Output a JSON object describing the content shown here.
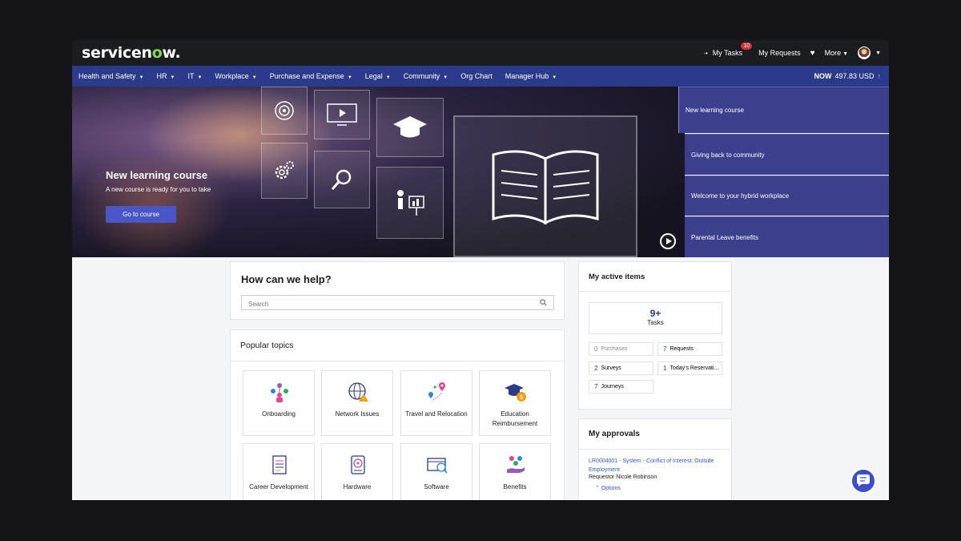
{
  "header": {
    "logo_text": "servicen",
    "logo_o": "o",
    "logo_tail": "w.",
    "my_tasks": "My Tasks",
    "tasks_badge": "10",
    "my_requests": "My Requests",
    "more": "More"
  },
  "nav": {
    "items": [
      "Health and Safety",
      "HR",
      "IT",
      "Workplace",
      "Purchase and Expense",
      "Legal",
      "Community",
      "Org Chart",
      "Manager Hub"
    ],
    "now_label": "NOW",
    "now_value": "497.83 USD"
  },
  "hero": {
    "title": "New learning course",
    "subtitle": "A new course is ready for you to take",
    "button": "Go to course",
    "list": [
      "New learning course",
      "Giving back to community",
      "Welcome to your hybrid workplace",
      "Parental Leave benefits"
    ]
  },
  "help": {
    "title": "How can we help?",
    "search_placeholder": "Search"
  },
  "topics": {
    "title": "Popular topics",
    "items": [
      "Onboarding",
      "Network Issues",
      "Travel and Relocation",
      "Education Reimbursement",
      "Career Development",
      "Hardware",
      "Software",
      "Benefits"
    ]
  },
  "active_items": {
    "title": "My active items",
    "tasks_count": "9+",
    "tasks_label": "Tasks",
    "purchases_count": "0",
    "purchases_label": "Purchases",
    "requests_count": "7",
    "requests_label": "Requests",
    "surveys_count": "2",
    "surveys_label": "Surveys",
    "reservations_count": "1",
    "reservations_label": "Today's Reservati...",
    "journeys_count": "7",
    "journeys_label": "Journeys"
  },
  "approvals": {
    "title": "My approvals",
    "link": "LR0004001 - System - Conflict of Interest: Outside Employment",
    "requestor": "Requestor Nicole Robinson",
    "options": "Options"
  },
  "colors": {
    "nav_bg": "#2c3a8c",
    "accent": "#4a55c7",
    "logo_green": "#7ed957",
    "badge_red": "#d22e3b"
  }
}
